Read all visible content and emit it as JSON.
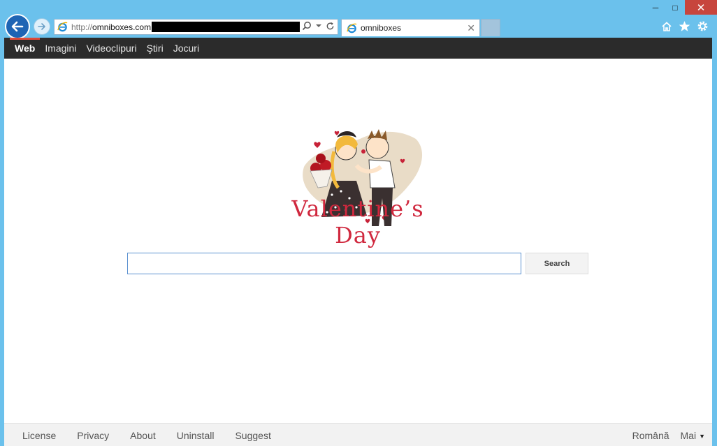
{
  "window": {
    "controls": {
      "minimize": "─",
      "maximize": "□",
      "close": "✕"
    }
  },
  "browser": {
    "address": {
      "scheme": "http://",
      "host": "omniboxes.com"
    },
    "tab": {
      "title": "omniboxes",
      "close": "✕"
    },
    "icons": [
      "back-arrow-icon",
      "forward-arrow-icon",
      "ie-icon",
      "search-icon",
      "dropdown-icon",
      "refresh-icon",
      "home-icon",
      "star-icon",
      "gear-icon"
    ]
  },
  "nav": {
    "items": [
      {
        "label": "Web",
        "active": true
      },
      {
        "label": "Imagini",
        "active": false
      },
      {
        "label": "Videoclipuri",
        "active": false
      },
      {
        "label": "Ştiri",
        "active": false
      },
      {
        "label": "Jocuri",
        "active": false
      }
    ]
  },
  "logo": {
    "text": "Valentine’s Day"
  },
  "search": {
    "value": "",
    "button_label": "Search"
  },
  "footer": {
    "links": [
      "License",
      "Privacy",
      "About",
      "Uninstall",
      "Suggest"
    ],
    "language": "Română",
    "more": "Mai"
  },
  "colors": {
    "chrome": "#6bc1ec",
    "nav_bg": "#2b2b2b",
    "nav_active": "#dd4b39",
    "logo_text": "#d0283e",
    "close_btn": "#c7453d"
  }
}
